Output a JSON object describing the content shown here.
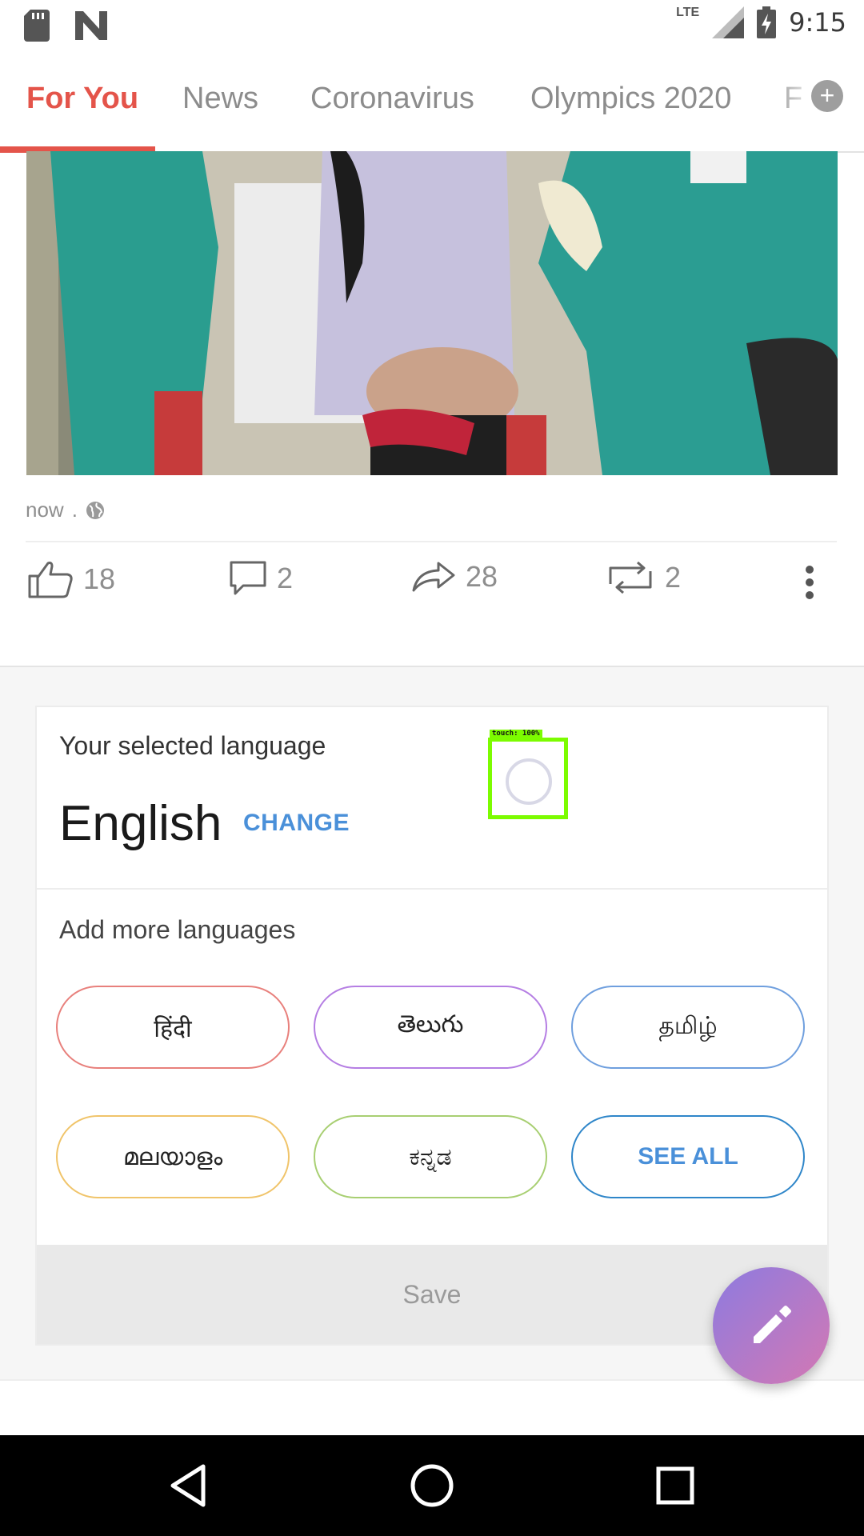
{
  "status_bar": {
    "time": "9:15",
    "network": "LTE",
    "icons": [
      "sd-card-icon",
      "n-app-icon",
      "signal-icon",
      "battery-charging-icon"
    ]
  },
  "tabs": [
    {
      "label": "For You",
      "active": true
    },
    {
      "label": "News",
      "active": false
    },
    {
      "label": "Coronavirus",
      "active": false
    },
    {
      "label": "Olympics 2020",
      "active": false
    },
    {
      "label": "F",
      "active": false
    }
  ],
  "add_tab_label": "+",
  "post": {
    "timestamp": "now",
    "separator": ".",
    "like_count": "18",
    "comment_count": "2",
    "share_count": "28",
    "repost_count": "2"
  },
  "language_card": {
    "selected_label": "Your selected language",
    "selected_language": "English",
    "change_label": "CHANGE",
    "more_label": "Add more languages",
    "options": [
      {
        "label": "हिंदी",
        "color": "#e8807c"
      },
      {
        "label": "తెలుగు",
        "color": "#b57ee3"
      },
      {
        "label": "தமிழ்",
        "color": "#6f9fde"
      },
      {
        "label": "മലയാളം",
        "color": "#f0c46a"
      },
      {
        "label": "ಕನ್ನಡ",
        "color": "#a8cf72"
      }
    ],
    "see_all_label": "SEE ALL",
    "save_label": "Save"
  },
  "touch_overlay": {
    "label": "touch: 100%"
  },
  "colors": {
    "accent": "#e4544a",
    "link": "#4a90d9",
    "touch": "#7cfc00"
  }
}
